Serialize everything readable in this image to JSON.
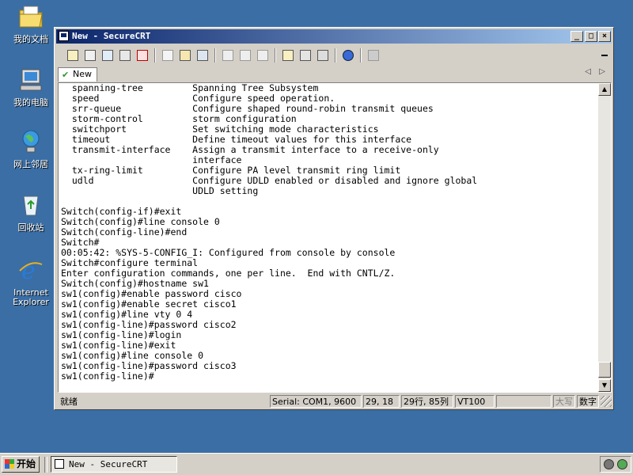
{
  "desktop": {
    "icons": [
      {
        "label": "我的文档",
        "icon": "folder-icon"
      },
      {
        "label": "我的电脑",
        "icon": "computer-icon"
      },
      {
        "label": "网上邻居",
        "icon": "network-icon"
      },
      {
        "label": "回收站",
        "icon": "recycle-bin-icon"
      },
      {
        "label": "Internet Explorer",
        "icon": "ie-icon"
      }
    ]
  },
  "window": {
    "title": "New - SecureCRT",
    "controls": {
      "minimize": "_",
      "maximize": "□",
      "close": "×"
    }
  },
  "tabs": [
    {
      "label": "New",
      "active": true
    }
  ],
  "terminal": {
    "lines": [
      "  spanning-tree         Spanning Tree Subsystem",
      "  speed                 Configure speed operation.",
      "  srr-queue             Configure shaped round-robin transmit queues",
      "  storm-control         storm configuration",
      "  switchport            Set switching mode characteristics",
      "  timeout               Define timeout values for this interface",
      "  transmit-interface    Assign a transmit interface to a receive-only",
      "                        interface",
      "  tx-ring-limit         Configure PA level transmit ring limit",
      "  udld                  Configure UDLD enabled or disabled and ignore global",
      "                        UDLD setting",
      "",
      "Switch(config-if)#exit",
      "Switch(config)#line console 0",
      "Switch(config-line)#end",
      "Switch#",
      "00:05:42: %SYS-5-CONFIG_I: Configured from console by console",
      "Switch#configure terminal",
      "Enter configuration commands, one per line.  End with CNTL/Z.",
      "Switch(config)#hostname sw1",
      "sw1(config)#enable password cisco",
      "sw1(config)#enable secret cisco1",
      "sw1(config)#line vty 0 4",
      "sw1(config-line)#password cisco2",
      "sw1(config-line)#login",
      "sw1(config-line)#exit",
      "sw1(config)#line console 0",
      "sw1(config-line)#password cisco3",
      "sw1(config-line)#"
    ]
  },
  "statusbar": {
    "ready": "就绪",
    "serial": "Serial: COM1, 9600",
    "cursor": "29, 18",
    "size": "29行, 85列",
    "terminal_type": "VT100",
    "caps": "大写",
    "num": "数字"
  },
  "taskbar": {
    "start_label": "开始",
    "task_label": "New - SecureCRT"
  }
}
